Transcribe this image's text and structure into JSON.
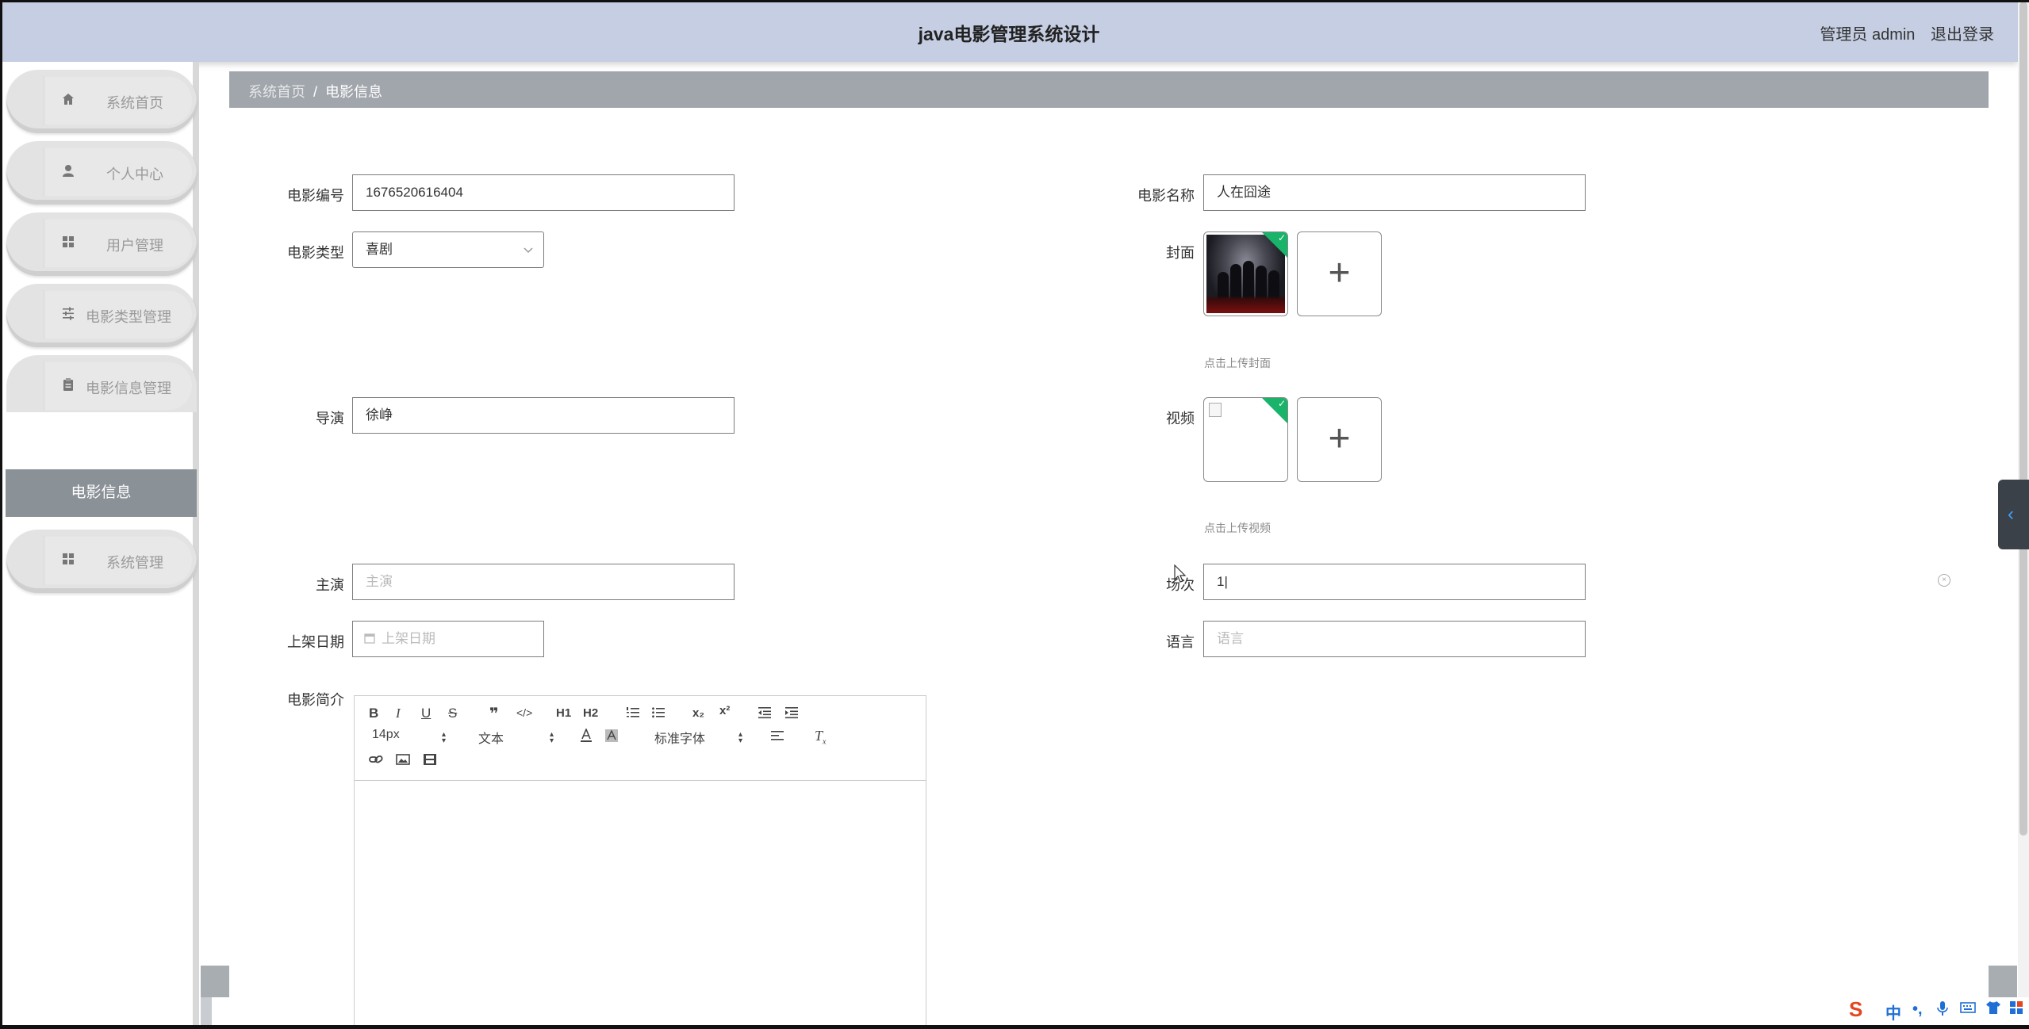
{
  "header": {
    "title": "java电影管理系统设计",
    "user_label": "管理员 admin",
    "logout_label": "退出登录"
  },
  "sidebar": {
    "items": [
      {
        "label": "系统首页",
        "icon": "home-icon"
      },
      {
        "label": "个人中心",
        "icon": "person-icon"
      },
      {
        "label": "用户管理",
        "icon": "grid-icon"
      },
      {
        "label": "电影类型管理",
        "icon": "sliders-icon"
      },
      {
        "label": "电影信息管理",
        "icon": "clipboard-icon"
      },
      {
        "label": "系统管理",
        "icon": "grid-icon"
      }
    ],
    "active_sub": "电影信息"
  },
  "breadcrumb": {
    "home": "系统首页",
    "separator": "/",
    "current": "电影信息"
  },
  "form": {
    "movie_no": {
      "label": "电影编号",
      "value": "1676520616404"
    },
    "movie_name": {
      "label": "电影名称",
      "value": "人在囧途"
    },
    "movie_type": {
      "label": "电影类型",
      "value": "喜剧"
    },
    "cover": {
      "label": "封面",
      "hint": "点击上传封面"
    },
    "director": {
      "label": "导演",
      "value": "徐峥"
    },
    "video": {
      "label": "视频",
      "hint": "点击上传视频"
    },
    "actor": {
      "label": "主演",
      "placeholder": "主演"
    },
    "session": {
      "label": "场次",
      "value": "1|"
    },
    "release_date": {
      "label": "上架日期",
      "placeholder": "上架日期"
    },
    "language": {
      "label": "语言",
      "placeholder": "语言"
    },
    "intro": {
      "label": "电影简介"
    }
  },
  "editor": {
    "row1": [
      "B",
      "I",
      "U",
      "S",
      "❞",
      "</>",
      "H1",
      "H2",
      "ol-list",
      "ul-list",
      "x₂",
      "x²",
      "outdent",
      "indent"
    ],
    "font_size": "14px",
    "text_style": "文本",
    "font_family": "标准字体"
  }
}
